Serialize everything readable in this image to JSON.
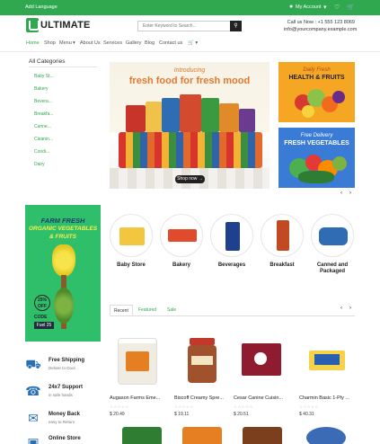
{
  "topbar": {
    "language": "Add Language",
    "account": "My Account",
    "user_icon": "user-icon",
    "account_chevron": "chevron-down-icon",
    "heart_icon": "heart-icon",
    "cart_icon": "cart-icon",
    "bg_color": "#2fa84f"
  },
  "brand": {
    "name": "ULTIMATE",
    "color": "#2fa84f"
  },
  "search": {
    "placeholder": "Enter Keyword to Search...",
    "icon": "search-icon"
  },
  "contact": {
    "call_label": "Call us Now :",
    "phone": "+1 555 123 8069",
    "email": "info@yourcompany.example.com"
  },
  "nav": {
    "items": [
      "Home",
      "Shop",
      "Menu",
      "About Us",
      "Services",
      "Gallery",
      "Blog",
      "Contact us"
    ],
    "active": "Home",
    "cart_icon": "cart-icon"
  },
  "sidebar": {
    "title": "All Categories",
    "categories": [
      "Baby St...",
      "Bakery",
      "Bevera...",
      "Breakfa...",
      "Canne...",
      "Cleanin...",
      "Condi...",
      "Dairy"
    ]
  },
  "hero": {
    "title_line1": "Introducing",
    "title_line2": "fresh food for fresh mood",
    "button": "Shop now →"
  },
  "promos": [
    {
      "line1": "Daily Fresh",
      "line2": "HEALTH & FRUITS"
    },
    {
      "line1": "Free Delivery",
      "line2": "FRESH VEGETABLES"
    }
  ],
  "left_banner": {
    "line1": "FARM FRESH",
    "line2": "ORGANIC VEGETABLES",
    "line3": "& FRUITS",
    "discount": "25% OFF",
    "code_label": "CODE",
    "code": "Fuel 25"
  },
  "category_circles": [
    {
      "label": "Baby Store"
    },
    {
      "label": "Bakery"
    },
    {
      "label": "Beverages"
    },
    {
      "label": "Breakfast"
    },
    {
      "label": "Canned and Packaged"
    }
  ],
  "tabs": [
    "Recent",
    "Featured",
    "Sale"
  ],
  "features": [
    {
      "title": "Free Shipping",
      "sub": "Deliver to Door",
      "icon": "truck-icon"
    },
    {
      "title": "24x7 Support",
      "sub": "in safe hands",
      "icon": "support-icon"
    },
    {
      "title": "Money Back",
      "sub": "easy to Return",
      "icon": "money-icon"
    },
    {
      "title": "Online Store",
      "sub": "",
      "icon": "card-icon"
    }
  ],
  "products": [
    {
      "name": "Augason Farms Eme...",
      "price": "$ 20.49",
      "stars": "☆☆☆☆☆"
    },
    {
      "name": "Biscoff Creamy Spre...",
      "price": "$ 19.11",
      "stars": "☆☆☆☆☆"
    },
    {
      "name": "Cesar Canine Cuisin...",
      "price": "$ 20.51",
      "stars": "☆☆☆☆☆"
    },
    {
      "name": "Charmin Basic 1-Ply ...",
      "price": "$ 40.31",
      "stars": "☆☆☆☆☆"
    }
  ],
  "arrows": {
    "prev": "‹",
    "next": "›"
  }
}
